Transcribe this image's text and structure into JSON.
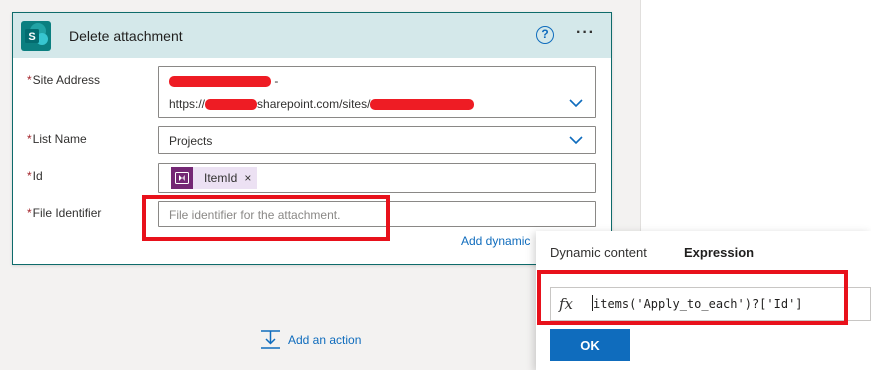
{
  "card": {
    "title": "Delete attachment",
    "help_icon": "?",
    "more_icon": "···",
    "fields": {
      "site_address": {
        "label": "Site Address",
        "line1_suffix": "-",
        "line2_prefix": "https://",
        "line2_mid": "sharepoint.com/sites/"
      },
      "list_name": {
        "label": "List Name",
        "value": "Projects"
      },
      "id": {
        "label": "Id",
        "token_label": "ItemId",
        "token_close": "×"
      },
      "file_identifier": {
        "label": "File Identifier",
        "placeholder": "File identifier for the attachment."
      }
    },
    "required_mark": "*",
    "add_dynamic_label": "Add dynamic"
  },
  "add_action": {
    "label": "Add an action"
  },
  "popup": {
    "tab_dynamic": "Dynamic content",
    "tab_expression": "Expression",
    "fx_icon": "fx",
    "expression": "items('Apply_to_each')?['Id']",
    "ok_label": "OK"
  },
  "colors": {
    "accent": "#0f6cbd",
    "header_bg": "#d4e8ea",
    "highlight": "#e8111b",
    "token_bg": "#ece1f3",
    "token_icon_bg": "#742774",
    "required": "#a4262c"
  }
}
